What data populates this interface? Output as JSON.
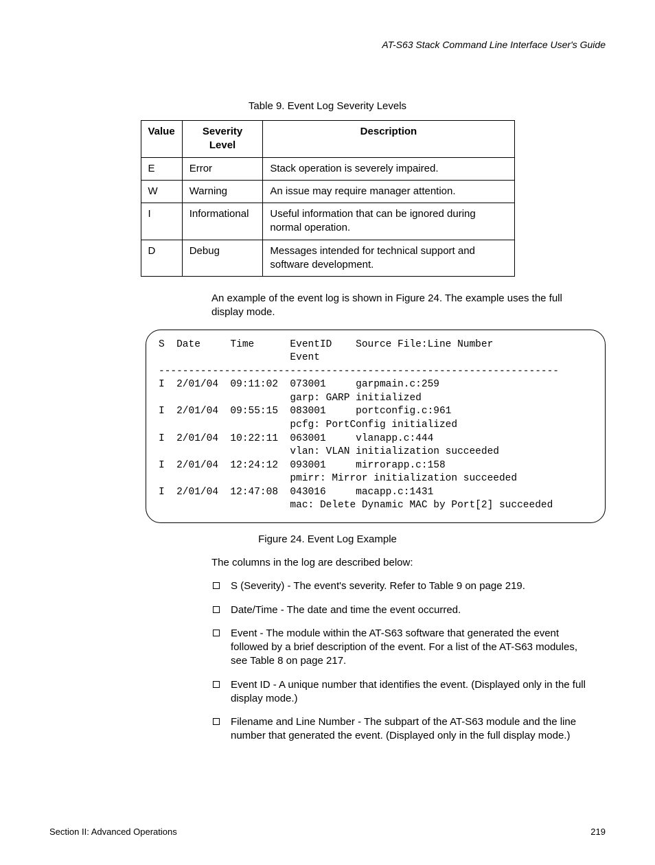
{
  "header": {
    "guide_title": "AT-S63 Stack Command Line Interface User's Guide"
  },
  "table": {
    "caption": "Table 9. Event Log Severity Levels",
    "headers": {
      "c1": "Value",
      "c2": "Severity Level",
      "c3": "Description"
    },
    "rows": [
      {
        "v": "E",
        "lvl": "Error",
        "desc": "Stack operation is severely impaired."
      },
      {
        "v": "W",
        "lvl": "Warning",
        "desc": "An issue may require manager attention."
      },
      {
        "v": "I",
        "lvl": "Informational",
        "desc": "Useful information that can be ignored during normal operation."
      },
      {
        "v": "D",
        "lvl": "Debug",
        "desc": "Messages intended for technical support and software development."
      }
    ]
  },
  "intro_para": "An example of the event log is shown in Figure 24. The example uses the full display mode.",
  "log_text": "S  Date     Time      EventID    Source File:Line Number\n                      Event\n-------------------------------------------------------------------\nI  2/01/04  09:11:02  073001     garpmain.c:259\n                      garp: GARP initialized\nI  2/01/04  09:55:15  083001     portconfig.c:961\n                      pcfg: PortConfig initialized\nI  2/01/04  10:22:11  063001     vlanapp.c:444\n                      vlan: VLAN initialization succeeded\nI  2/01/04  12:24:12  093001     mirrorapp.c:158\n                      pmirr: Mirror initialization succeeded\nI  2/01/04  12:47:08  043016     macapp.c:1431\n                      mac: Delete Dynamic MAC by Port[2] succeeded",
  "figure_caption": "Figure 24. Event Log Example",
  "columns_intro": "The columns in the log are described below:",
  "bullets": [
    "S (Severity) - The event's severity. Refer to Table 9 on page 219.",
    "Date/Time - The date and time the event occurred.",
    "Event - The module within the AT-S63 software that generated the event followed by a brief description of the event. For a list of the AT-S63 modules, see Table 8 on page 217.",
    "Event ID - A unique number that identifies the event. (Displayed only in the full display mode.)",
    "Filename and Line Number - The subpart of the AT-S63 module and the line number that generated the event. (Displayed only in the full display mode.)"
  ],
  "footer": {
    "section": "Section II: Advanced Operations",
    "page": "219"
  }
}
